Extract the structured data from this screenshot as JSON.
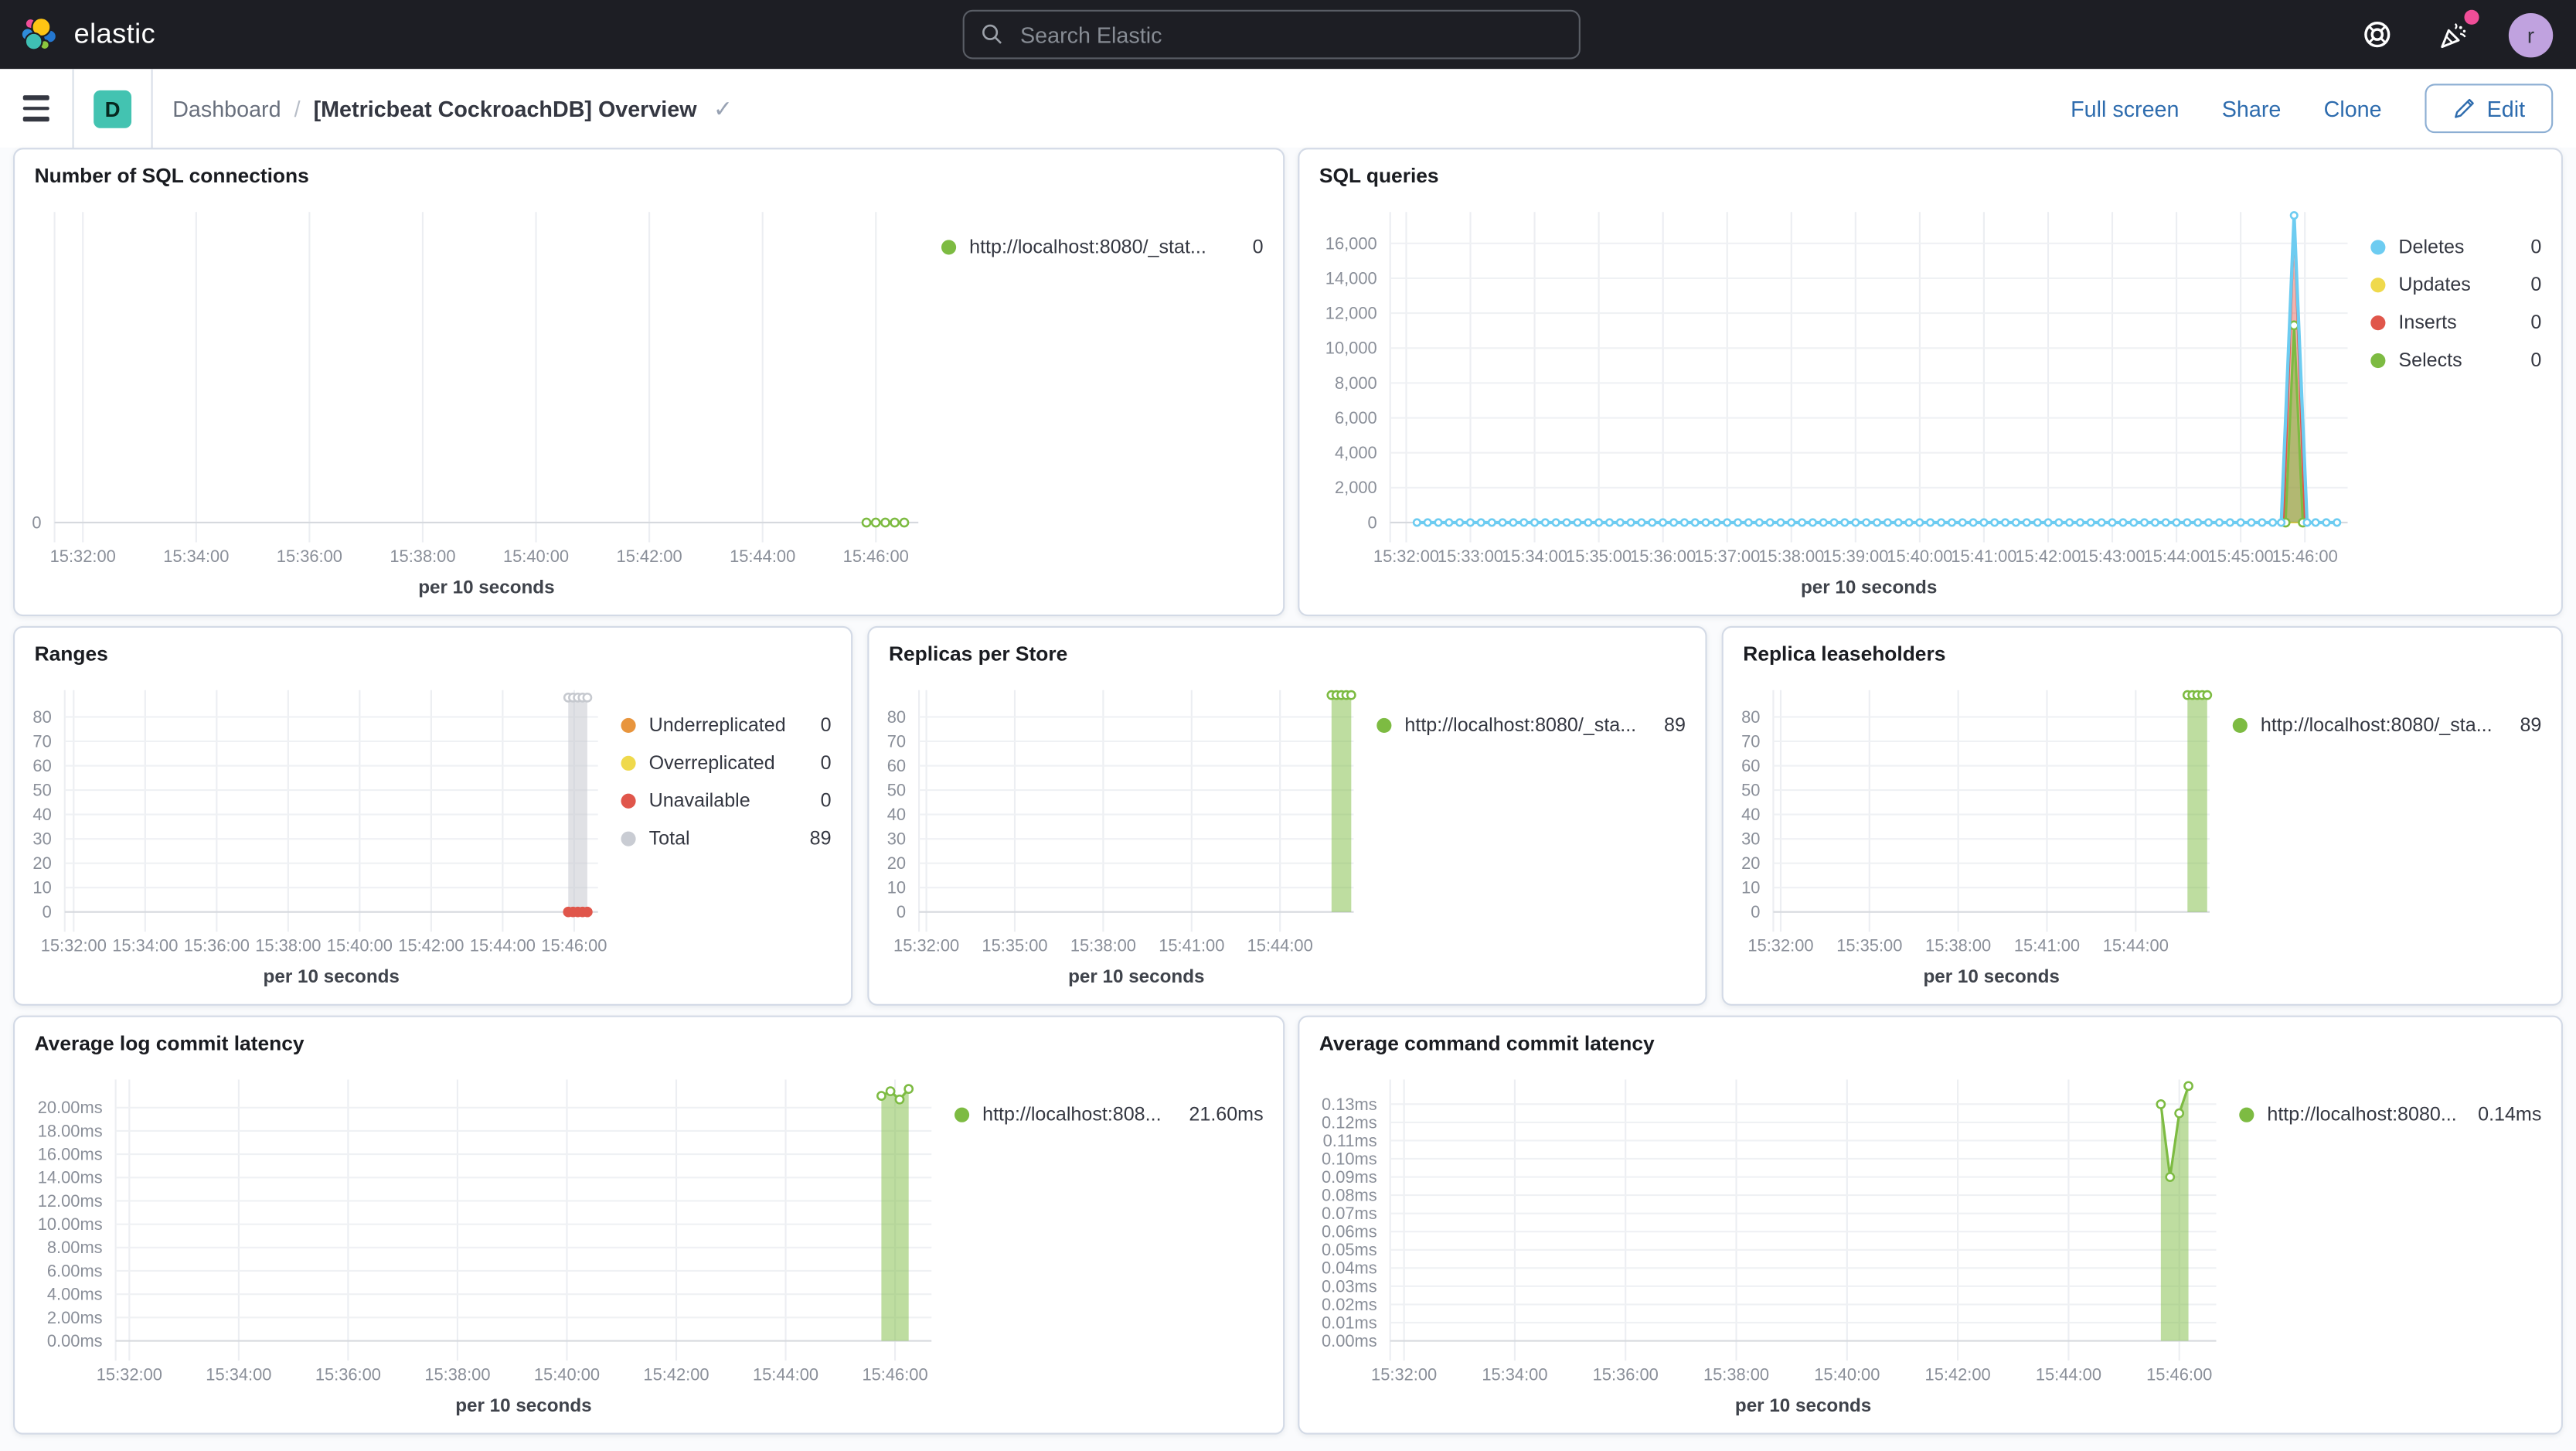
{
  "header": {
    "brand": "elastic",
    "search_placeholder": "Search Elastic",
    "avatar_initial": "r"
  },
  "toolbar": {
    "app_badge": "D",
    "breadcrumb_root": "Dashboard",
    "breadcrumb_sep": "/",
    "title": "[Metricbeat CockroachDB] Overview",
    "saved_check": "✓",
    "actions": {
      "full_screen": "Full screen",
      "share": "Share",
      "clone": "Clone"
    },
    "edit_label": "Edit"
  },
  "colors": {
    "accent_blue": "#2e6cae",
    "series_green": "#7dbb42",
    "series_light_blue": "#6dccf1",
    "series_yellow": "#efd94c",
    "series_red": "#e0564b",
    "series_orange": "#e8953d",
    "series_gray": "#c9ccd3",
    "badge_teal": "#43c3b1",
    "notification_pink": "#f04e98"
  },
  "panels": [
    {
      "id": "sql-connections",
      "title": "Number of SQL connections",
      "legend": {
        "items": [
          {
            "label": "http://localhost:8080/_stat...",
            "value": "0",
            "color": "#7dbb42"
          }
        ]
      },
      "chart": {
        "type": "line",
        "x_domain": [
          "15:31:30",
          "15:46:45"
        ],
        "x_ticks": [
          "15:32:00",
          "15:34:00",
          "15:36:00",
          "15:38:00",
          "15:40:00",
          "15:42:00",
          "15:44:00",
          "15:46:00"
        ],
        "y_tick_values": [
          0
        ],
        "y_tick_labels": [
          "0"
        ],
        "y_top": 1,
        "xlabel": "per 10 seconds",
        "series": [
          {
            "name": "http://localhost:8080/_stat...",
            "color": "#7dbb42",
            "line_width": 1.5,
            "marker": "open",
            "marker_size": 2.4,
            "gens": [
              {
                "from": "15:45:50",
                "to": "15:46:30",
                "step_s": 10,
                "value": 0
              }
            ]
          }
        ]
      }
    },
    {
      "id": "sql-queries",
      "title": "SQL queries",
      "legend": {
        "items": [
          {
            "label": "Deletes",
            "value": "0",
            "color": "#6dccf1"
          },
          {
            "label": "Updates",
            "value": "0",
            "color": "#efd94c"
          },
          {
            "label": "Inserts",
            "value": "0",
            "color": "#e0564b"
          },
          {
            "label": "Selects",
            "value": "0",
            "color": "#7dbb42"
          }
        ]
      },
      "chart": {
        "type": "line-area",
        "x_domain": [
          "15:31:45",
          "15:46:40"
        ],
        "x_ticks": [
          "15:32:00",
          "15:33:00",
          "15:34:00",
          "15:35:00",
          "15:36:00",
          "15:37:00",
          "15:38:00",
          "15:39:00",
          "15:40:00",
          "15:41:00",
          "15:42:00",
          "15:43:00",
          "15:44:00",
          "15:45:00",
          "15:46:00"
        ],
        "y_tick_values": [
          0,
          2000,
          4000,
          6000,
          8000,
          10000,
          12000,
          14000,
          16000
        ],
        "y_tick_labels": [
          "0",
          "2,000",
          "4,000",
          "6,000",
          "8,000",
          "10,000",
          "12,000",
          "14,000",
          "16,000"
        ],
        "y_top": 17800,
        "xlabel": "per 10 seconds",
        "series": [
          {
            "name": "Updates",
            "color": "#efd94c",
            "line_width": 1,
            "marker": "none",
            "points": [
              [
                "15:45:40",
                0
              ],
              [
                "15:46:00",
                0
              ]
            ]
          },
          {
            "name": "Inserts",
            "color": "#e0564b",
            "line_width": 1.5,
            "marker": "none",
            "fill": true,
            "fill_opacity": 0.45,
            "points": [
              [
                "15:45:40",
                0
              ],
              [
                "15:45:50",
                17350
              ],
              [
                "15:46:00",
                0
              ]
            ]
          },
          {
            "name": "Selects",
            "color": "#7dbb42",
            "line_width": 1.5,
            "marker": "open",
            "marker_size": 2.4,
            "fill": true,
            "fill_opacity": 0.55,
            "points": [
              [
                "15:45:42",
                0
              ],
              [
                "15:45:50",
                11300
              ],
              [
                "15:45:58",
                0
              ]
            ]
          },
          {
            "name": "Deletes",
            "color": "#6dccf1",
            "line_width": 2,
            "marker": "open",
            "marker_size": 2,
            "gens": [
              {
                "from": "15:32:10",
                "to": "15:45:30",
                "step_s": 10,
                "value": 0
              },
              {
                "from": "15:46:10",
                "to": "15:46:30",
                "step_s": 10,
                "value": 0
              }
            ],
            "points": [
              [
                "15:45:38",
                0
              ],
              [
                "15:45:50",
                17600
              ],
              [
                "15:46:02",
                0
              ]
            ]
          }
        ]
      }
    },
    {
      "id": "ranges",
      "title": "Ranges",
      "legend": {
        "items": [
          {
            "label": "Underreplicated",
            "value": "0",
            "color": "#e8953d"
          },
          {
            "label": "Overreplicated",
            "value": "0",
            "color": "#efd94c"
          },
          {
            "label": "Unavailable",
            "value": "0",
            "color": "#e0564b"
          },
          {
            "label": "Total",
            "value": "89",
            "color": "#c9ccd3"
          }
        ]
      },
      "chart": {
        "type": "line-area",
        "x_domain": [
          "15:31:45",
          "15:46:40"
        ],
        "x_ticks": [
          "15:32:00",
          "15:34:00",
          "15:36:00",
          "15:38:00",
          "15:40:00",
          "15:42:00",
          "15:44:00",
          "15:46:00"
        ],
        "y_tick_values": [
          0,
          10,
          20,
          30,
          40,
          50,
          60,
          70,
          80
        ],
        "y_tick_labels": [
          "0",
          "10",
          "20",
          "30",
          "40",
          "50",
          "60",
          "70",
          "80"
        ],
        "y_top": 91,
        "xlabel": "per 10 seconds",
        "series": [
          {
            "name": "Underreplicated",
            "color": "#e8953d",
            "line_width": 1,
            "marker": "none",
            "gens": [
              {
                "from": "15:45:50",
                "to": "15:46:22",
                "step_s": 8,
                "value": 0
              }
            ]
          },
          {
            "name": "Overreplicated",
            "color": "#efd94c",
            "line_width": 1,
            "marker": "none",
            "gens": [
              {
                "from": "15:45:50",
                "to": "15:46:22",
                "step_s": 8,
                "value": 0
              }
            ]
          },
          {
            "name": "Total",
            "color": "#c6c9cf",
            "line_width": 1.2,
            "marker": "open",
            "marker_size": 2.4,
            "fill": true,
            "fill_opacity": 0.55,
            "gens": [
              {
                "from": "15:45:50",
                "to": "15:46:22",
                "step_s": 8,
                "value": 88
              }
            ]
          },
          {
            "name": "Unavailable",
            "color": "#e0564b",
            "line_width": 2,
            "marker": "filled",
            "marker_size": 2.6,
            "gens": [
              {
                "from": "15:45:50",
                "to": "15:46:22",
                "step_s": 8,
                "value": 0
              }
            ]
          }
        ]
      }
    },
    {
      "id": "replicas-per-store",
      "title": "Replicas per Store",
      "legend": {
        "items": [
          {
            "label": "http://localhost:8080/_sta...",
            "value": "89",
            "color": "#7dbb42"
          }
        ]
      },
      "chart": {
        "type": "area",
        "x_domain": [
          "15:31:45",
          "15:46:30"
        ],
        "x_ticks": [
          "15:32:00",
          "15:35:00",
          "15:38:00",
          "15:41:00",
          "15:44:00"
        ],
        "y_tick_values": [
          0,
          10,
          20,
          30,
          40,
          50,
          60,
          70,
          80
        ],
        "y_tick_labels": [
          "0",
          "10",
          "20",
          "30",
          "40",
          "50",
          "60",
          "70",
          "80"
        ],
        "y_top": 91,
        "xlabel": "per 10 seconds",
        "series": [
          {
            "name": "http://localhost:8080/_sta...",
            "color": "#7dbb42",
            "line_width": 1.5,
            "marker": "open",
            "marker_size": 2.4,
            "fill": true,
            "fill_opacity": 0.5,
            "gens": [
              {
                "from": "15:45:45",
                "to": "15:46:30",
                "step_s": 10,
                "value": 89
              }
            ]
          }
        ]
      }
    },
    {
      "id": "replica-leaseholders",
      "title": "Replica leaseholders",
      "legend": {
        "items": [
          {
            "label": "http://localhost:8080/_sta...",
            "value": "89",
            "color": "#7dbb42"
          }
        ]
      },
      "chart": {
        "type": "area",
        "x_domain": [
          "15:31:45",
          "15:46:30"
        ],
        "x_ticks": [
          "15:32:00",
          "15:35:00",
          "15:38:00",
          "15:41:00",
          "15:44:00"
        ],
        "y_tick_values": [
          0,
          10,
          20,
          30,
          40,
          50,
          60,
          70,
          80
        ],
        "y_tick_labels": [
          "0",
          "10",
          "20",
          "30",
          "40",
          "50",
          "60",
          "70",
          "80"
        ],
        "y_top": 91,
        "xlabel": "per 10 seconds",
        "series": [
          {
            "name": "http://localhost:8080/_sta...",
            "color": "#7dbb42",
            "line_width": 1.5,
            "marker": "open",
            "marker_size": 2.4,
            "fill": true,
            "fill_opacity": 0.5,
            "gens": [
              {
                "from": "15:45:45",
                "to": "15:46:30",
                "step_s": 10,
                "value": 89
              }
            ]
          }
        ]
      }
    },
    {
      "id": "avg-log-commit-latency",
      "title": "Average log commit latency",
      "legend": {
        "items": [
          {
            "label": "http://localhost:808...",
            "value": "21.60ms",
            "color": "#7dbb42"
          }
        ]
      },
      "chart": {
        "type": "area",
        "x_domain": [
          "15:31:45",
          "15:46:40"
        ],
        "x_ticks": [
          "15:32:00",
          "15:34:00",
          "15:36:00",
          "15:38:00",
          "15:40:00",
          "15:42:00",
          "15:44:00",
          "15:46:00"
        ],
        "y_tick_values": [
          0,
          2,
          4,
          6,
          8,
          10,
          12,
          14,
          16,
          18,
          20
        ],
        "y_tick_labels": [
          "0.00ms",
          "2.00ms",
          "4.00ms",
          "6.00ms",
          "8.00ms",
          "10.00ms",
          "12.00ms",
          "14.00ms",
          "16.00ms",
          "18.00ms",
          "20.00ms"
        ],
        "y_top": 22.4,
        "xlabel": "per 10 seconds",
        "series": [
          {
            "name": "http://localhost:808...",
            "color": "#7dbb42",
            "line_width": 1.5,
            "marker": "open",
            "marker_size": 2.4,
            "fill": true,
            "fill_opacity": 0.5,
            "points": [
              [
                "15:45:45",
                21.0
              ],
              [
                "15:45:55",
                21.4
              ],
              [
                "15:46:05",
                20.7
              ],
              [
                "15:46:15",
                21.6
              ]
            ]
          }
        ]
      }
    },
    {
      "id": "avg-command-commit-latency",
      "title": "Average command commit latency",
      "legend": {
        "items": [
          {
            "label": "http://localhost:8080...",
            "value": "0.14ms",
            "color": "#7dbb42"
          }
        ]
      },
      "chart": {
        "type": "area",
        "x_domain": [
          "15:31:45",
          "15:46:40"
        ],
        "x_ticks": [
          "15:32:00",
          "15:34:00",
          "15:36:00",
          "15:38:00",
          "15:40:00",
          "15:42:00",
          "15:44:00",
          "15:46:00"
        ],
        "y_tick_values": [
          0,
          0.01,
          0.02,
          0.03,
          0.04,
          0.05,
          0.06,
          0.07,
          0.08,
          0.09,
          0.1,
          0.11,
          0.12,
          0.13
        ],
        "y_tick_labels": [
          "0.00ms",
          "0.01ms",
          "0.02ms",
          "0.03ms",
          "0.04ms",
          "0.05ms",
          "0.06ms",
          "0.07ms",
          "0.08ms",
          "0.09ms",
          "0.10ms",
          "0.11ms",
          "0.12ms",
          "0.13ms"
        ],
        "y_top": 0.1435,
        "xlabel": "per 10 seconds",
        "series": [
          {
            "name": "http://localhost:8080...",
            "color": "#7dbb42",
            "line_width": 1.5,
            "marker": "open",
            "marker_size": 2.4,
            "fill": true,
            "fill_opacity": 0.5,
            "points": [
              [
                "15:45:40",
                0.13
              ],
              [
                "15:45:50",
                0.09
              ],
              [
                "15:46:00",
                0.125
              ],
              [
                "15:46:10",
                0.14
              ]
            ]
          }
        ]
      }
    }
  ]
}
